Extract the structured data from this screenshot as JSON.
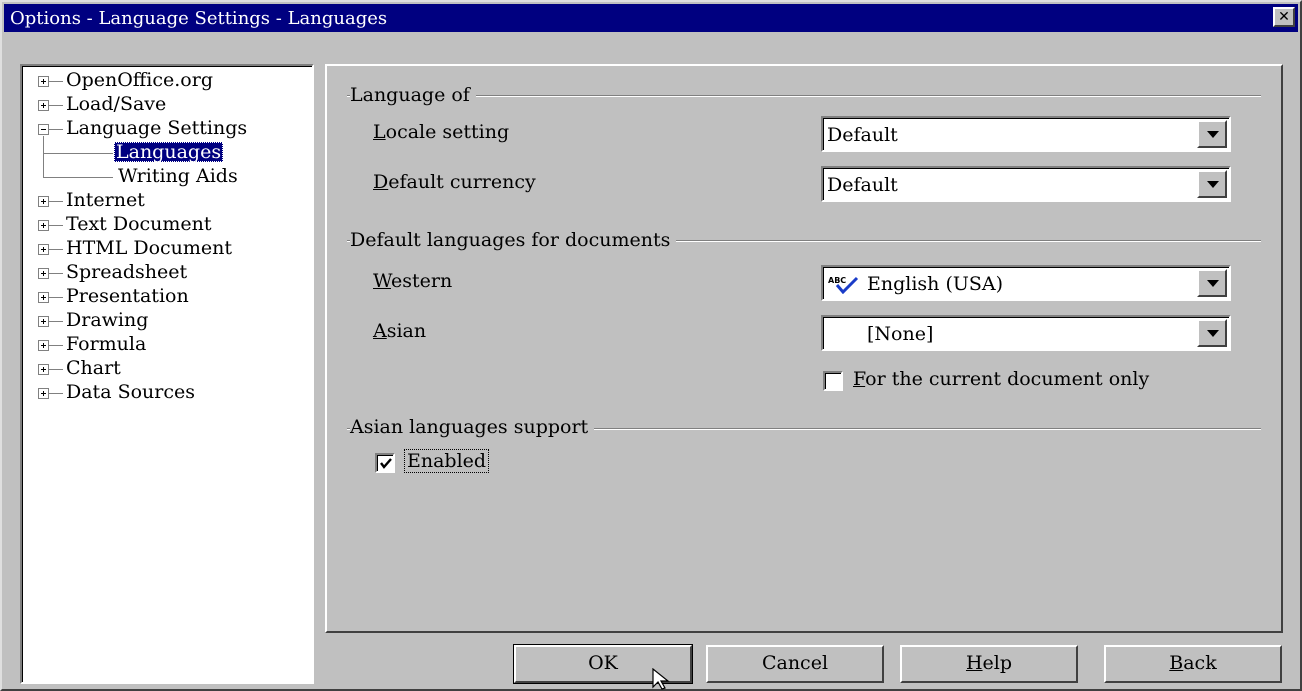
{
  "window": {
    "title": "Options - Language Settings - Languages",
    "close_label": "✕"
  },
  "tree": {
    "items": [
      {
        "label": "OpenOffice.org",
        "expander": "plus"
      },
      {
        "label": "Load/Save",
        "expander": "plus"
      },
      {
        "label": "Language Settings",
        "expander": "minus"
      },
      {
        "label": "Languages",
        "selected": true
      },
      {
        "label": "Writing Aids"
      },
      {
        "label": "Internet",
        "expander": "plus"
      },
      {
        "label": "Text Document",
        "expander": "plus"
      },
      {
        "label": "HTML Document",
        "expander": "plus"
      },
      {
        "label": "Spreadsheet",
        "expander": "plus"
      },
      {
        "label": "Presentation",
        "expander": "plus"
      },
      {
        "label": "Drawing",
        "expander": "plus"
      },
      {
        "label": "Formula",
        "expander": "plus"
      },
      {
        "label": "Chart",
        "expander": "plus"
      },
      {
        "label": "Data Sources",
        "expander": "plus"
      }
    ]
  },
  "language_of": {
    "title": "Language of",
    "locale_label_key": "L",
    "locale_label_rest": "ocale setting",
    "locale_value": "Default",
    "currency_label_key": "D",
    "currency_label_rest": "efault currency",
    "currency_value": "Default"
  },
  "default_languages": {
    "title": "Default languages for documents",
    "western_label_key": "W",
    "western_label_rest": "estern",
    "western_value": "English (USA)",
    "asian_label_key": "A",
    "asian_label_rest": "sian",
    "asian_value": "[None]",
    "current_doc_key": "F",
    "current_doc_rest": "or the current document only",
    "current_doc_checked": false
  },
  "asian_support": {
    "title": "Asian languages support",
    "enabled_label": "Enabled",
    "enabled_checked": true
  },
  "buttons": {
    "ok": "OK",
    "cancel": "Cancel",
    "help_key": "H",
    "help_rest": "elp",
    "back_key": "B",
    "back_rest": "ack"
  },
  "icons": {
    "spellcheck": "abc-check-icon",
    "expander_plus": "plus-box-icon",
    "expander_minus": "minus-box-icon",
    "dropdown": "dropdown-arrow-icon"
  }
}
